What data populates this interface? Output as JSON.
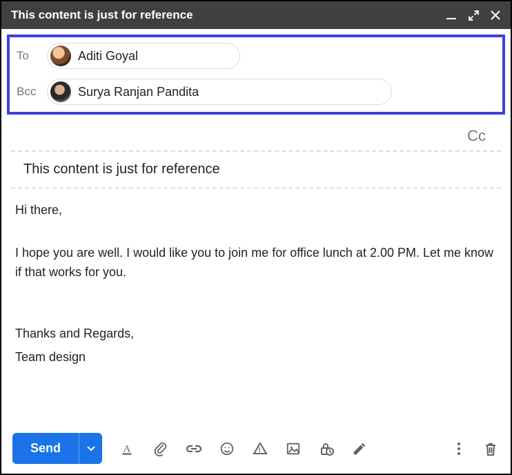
{
  "header": {
    "title": "This content is just for reference"
  },
  "recipients": {
    "to_label": "To",
    "to_name": "Aditi Goyal",
    "bcc_label": "Bcc",
    "bcc_name": "Surya Ranjan Pandita",
    "cc_label": "Cc"
  },
  "subject": "This content is just for reference",
  "body": {
    "greeting": "Hi there,",
    "para1": "I hope you are well. I would like you to join me for office lunch at 2.00 PM. Let me know if that works for you.",
    "signoff1": "Thanks and Regards,",
    "signoff2": "Team design"
  },
  "toolbar": {
    "send_label": "Send"
  }
}
